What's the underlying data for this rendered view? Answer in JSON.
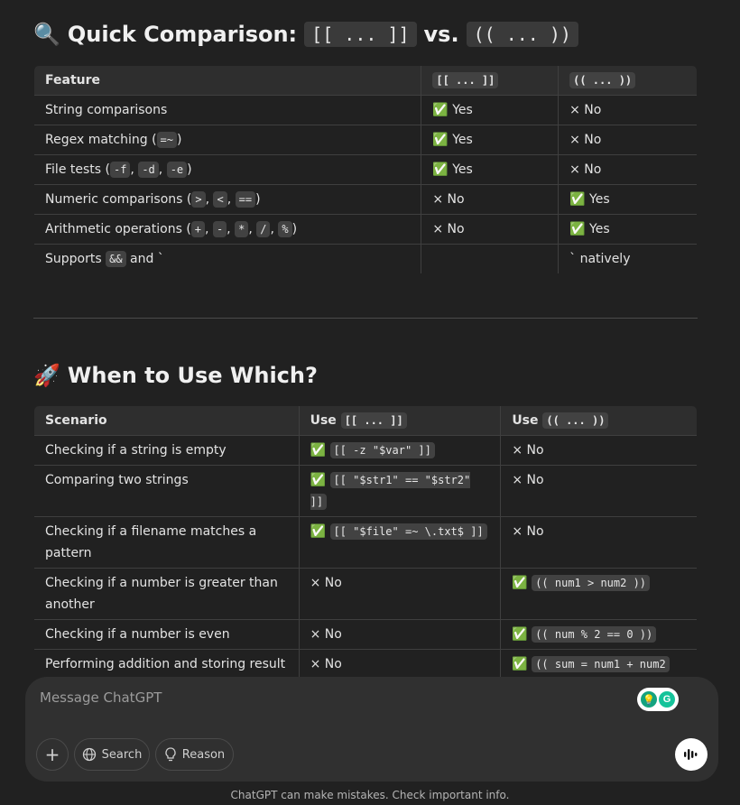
{
  "section1": {
    "icon": "magnifier-emoji",
    "title_prefix": "Quick Comparison:",
    "title_code_a": "[[ ... ]]",
    "title_vs": "vs.",
    "title_code_b": "(( ... ))",
    "headers": [
      "Feature",
      "[[ ... ]]",
      "(( ... ))"
    ],
    "rows": [
      {
        "f_text": "String comparisons",
        "a": "✅ Yes",
        "b": "× No"
      },
      {
        "f_text": "Regex matching (",
        "f_codes": [
          "=~"
        ],
        "f_tail": ")",
        "a": "✅ Yes",
        "b": "× No"
      },
      {
        "f_text": "File tests (",
        "f_codes": [
          "-f",
          "-d",
          "-e"
        ],
        "f_tail": ")",
        "a": "✅ Yes",
        "b": "× No"
      },
      {
        "f_text": "Numeric comparisons (",
        "f_codes": [
          ">",
          "<",
          "=="
        ],
        "f_tail": ")",
        "a": "× No",
        "b": "✅ Yes"
      },
      {
        "f_text": "Arithmetic operations (",
        "f_codes": [
          "+",
          "-",
          "*",
          "/",
          "%"
        ],
        "f_tail": ")",
        "a": "× No",
        "b": "✅ Yes"
      },
      {
        "f_text": "Supports ",
        "f_codes": [
          "&&"
        ],
        "f_tail": " and `",
        "a": "",
        "b": "` natively"
      }
    ]
  },
  "section2": {
    "icon": "rocket-emoji",
    "title": "When to Use Which?",
    "headers": {
      "scenario": "Scenario",
      "use_a_label": "Use",
      "use_a_code": "[[ ... ]]",
      "use_b_label": "Use",
      "use_b_code": "(( ... ))"
    },
    "rows": [
      {
        "scenario": "Checking if a string is empty",
        "a_mark": "✅",
        "a_code": "[[ -z \"$var\" ]]",
        "b_text": "× No"
      },
      {
        "scenario": "Comparing two strings",
        "a_mark": "✅",
        "a_code": "[[ \"$str1\" == \"$str2\" ]]",
        "b_text": "× No"
      },
      {
        "scenario": "Checking if a filename matches a pattern",
        "a_mark": "✅",
        "a_code": "[[ \"$file\" =~ \\.txt$ ]]",
        "b_text": "× No"
      },
      {
        "scenario": "Checking if a number is greater than another",
        "a_text": "× No",
        "b_mark": "✅",
        "b_code": "(( num1 > num2 ))"
      },
      {
        "scenario": "Checking if a number is even",
        "a_text": "× No",
        "b_mark": "✅",
        "b_code": "(( num % 2 == 0 ))"
      },
      {
        "scenario": "Performing addition and storing result",
        "a_text": "× No",
        "b_mark": "✅",
        "b_code": "(( sum = num1 + num2"
      }
    ]
  },
  "composer": {
    "placeholder": "Message ChatGPT",
    "search_label": "Search",
    "reason_label": "Reason"
  },
  "footer": "ChatGPT can make mistakes. Check important info."
}
